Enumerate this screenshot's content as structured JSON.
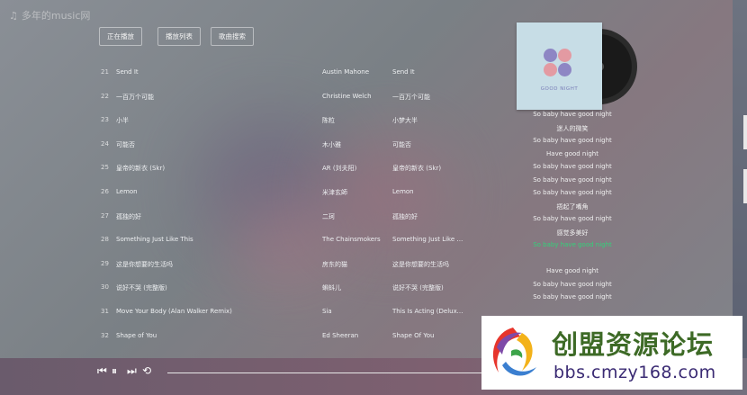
{
  "app": {
    "title": "多年的music网",
    "icon": "music-note-icon"
  },
  "tabs": [
    "正在播放",
    "播放列表",
    "歌曲搜索"
  ],
  "tracks": [
    {
      "num": "21",
      "title": "Send It",
      "artist": "Austin Mahone",
      "album": "Send It"
    },
    {
      "num": "22",
      "title": "一百万个可能",
      "artist": "Christine Welch",
      "album": "一百万个可能"
    },
    {
      "num": "23",
      "title": "小半",
      "artist": "陈粒",
      "album": "小梦大半"
    },
    {
      "num": "24",
      "title": "可能否",
      "artist": "木小雅",
      "album": "可能否"
    },
    {
      "num": "25",
      "title": "皇帝的新衣 (Skr)",
      "artist": "AR (刘夫阳)",
      "album": "皇帝的新衣 (Skr)"
    },
    {
      "num": "26",
      "title": "Lemon",
      "artist": "米津玄師",
      "album": "Lemon"
    },
    {
      "num": "27",
      "title": "孤独的好",
      "artist": "二珂",
      "album": "孤独的好"
    },
    {
      "num": "28",
      "title": "Something Just Like This",
      "artist": "The Chainsmokers",
      "album": "Something Just Like T..."
    },
    {
      "num": "29",
      "title": "这是你想要的生活吗",
      "artist": "房东的猫",
      "album": "这是你想要的生活吗"
    },
    {
      "num": "30",
      "title": "说好不哭 (完整版)",
      "artist": "蝌蚪儿",
      "album": "说好不哭 (完整版)"
    },
    {
      "num": "31",
      "title": "Move Your Body (Alan Walker Remix)",
      "artist": "Sia",
      "album": "This Is Acting (Deluxe..."
    },
    {
      "num": "32",
      "title": "Shape of You",
      "artist": "Ed Sheeran",
      "album": "Shape Of You"
    }
  ],
  "cover": {
    "caption": "GOOD NIGHT"
  },
  "lyrics": [
    {
      "text": "So baby have good night",
      "active": false
    },
    {
      "text": "迷人的微笑",
      "active": false
    },
    {
      "text": "So baby have good night",
      "active": false
    },
    {
      "text": "Have good night",
      "active": false
    },
    {
      "text": "So baby have good night",
      "active": false
    },
    {
      "text": "So baby have good night",
      "active": false
    },
    {
      "text": "So baby have good night",
      "active": false
    },
    {
      "text": "捂起了嘴角",
      "active": false
    },
    {
      "text": "So baby have good night",
      "active": false
    },
    {
      "text": "感觉多美好",
      "active": false
    },
    {
      "text": "So baby have good night",
      "active": true
    },
    {
      "text": "",
      "active": false
    },
    {
      "text": "Have good night",
      "active": false
    },
    {
      "text": "So baby have good night",
      "active": false
    },
    {
      "text": "So baby have good night",
      "active": false
    }
  ],
  "player": {
    "icons": [
      "skip-previous-icon",
      "pause-icon",
      "skip-next-icon",
      "loop-icon"
    ]
  },
  "watermark": {
    "title": "创盟资源论坛",
    "url": "bbs.cmzy168.com"
  },
  "colors": {
    "lyric_active": "#34d17a",
    "watermark_title": "#3d6a26",
    "watermark_url": "#3a2a73"
  }
}
